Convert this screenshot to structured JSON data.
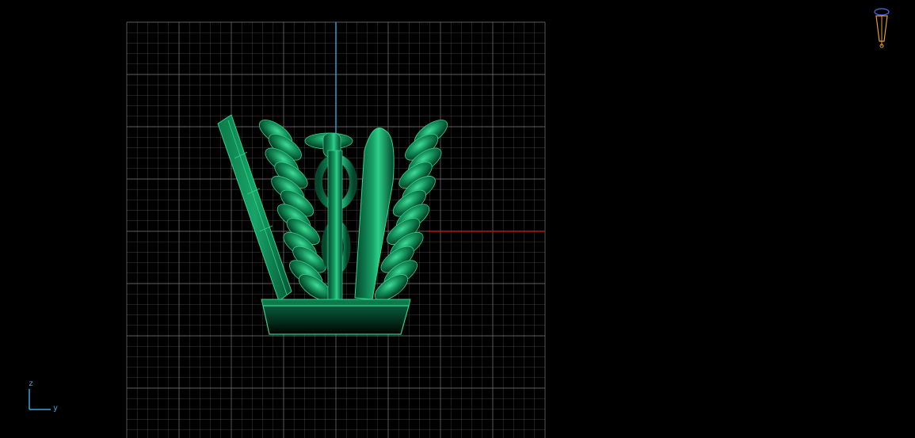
{
  "viewport": {
    "view": "right",
    "background": "#000000",
    "grid_color": "#6f6f6f",
    "model_color": "#0f8a55",
    "model_edge_color": "#33d48a"
  },
  "axes_widget": {
    "vertical_label": "z",
    "horizontal_label": "y",
    "color": "#3aa6d8"
  },
  "origin_axes": {
    "vertical_color": "#2aa0c8",
    "horizontal_color": "#b01a10"
  },
  "view_gizmo": {
    "icon": "camera-icon",
    "color": "#e0a020",
    "accent_color": "#4a6cff"
  }
}
